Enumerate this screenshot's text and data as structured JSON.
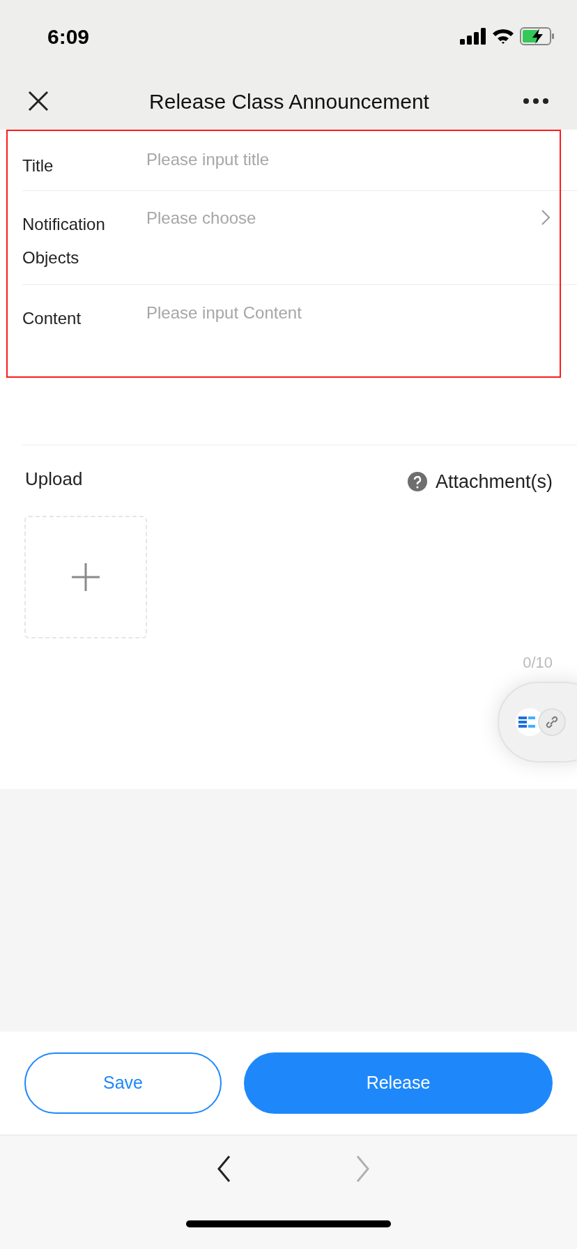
{
  "status_bar": {
    "time": "6:09"
  },
  "nav": {
    "title": "Release Class Announcement"
  },
  "form": {
    "highlighted": true,
    "fields": [
      {
        "kind": "text",
        "label": "Title",
        "placeholder": "Please input title"
      },
      {
        "kind": "select",
        "label": "Notification Objects",
        "placeholder": "Please choose"
      },
      {
        "kind": "textarea",
        "label": "Content",
        "placeholder": "Please input Content"
      }
    ]
  },
  "upload": {
    "label": "Upload",
    "attachment_label": "Attachment(s)",
    "counter": "0/10"
  },
  "buttons": [
    {
      "kind": "outline",
      "label": "Save"
    },
    {
      "kind": "primary",
      "label": "Release"
    }
  ],
  "toolbar": {
    "back": {
      "disabled": false
    },
    "forward": {
      "disabled": true
    }
  }
}
